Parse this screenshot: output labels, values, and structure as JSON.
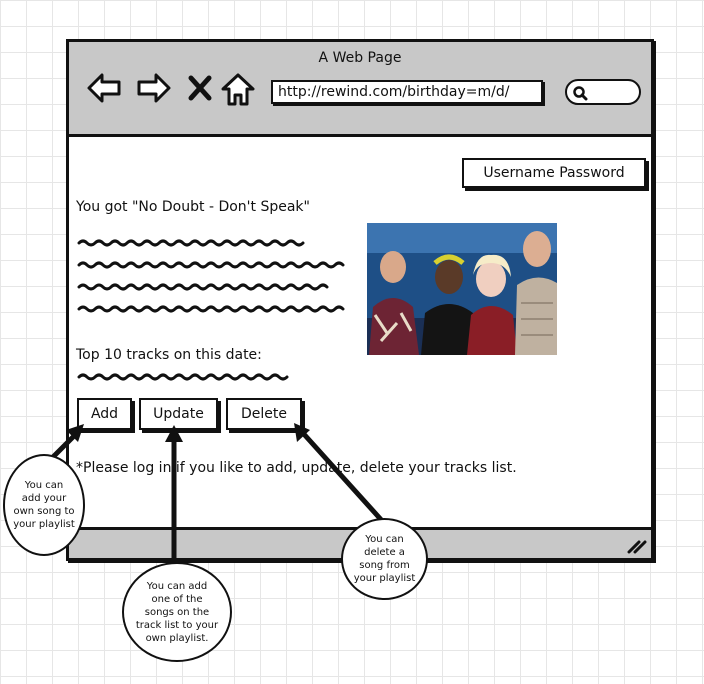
{
  "browser": {
    "window_title": "A Web Page",
    "url": "http://rewind.com/birthday=m/d/",
    "nav_icons": [
      "back-arrow-icon",
      "forward-arrow-icon",
      "stop-icon",
      "home-icon"
    ],
    "search_icon": "magnifier-icon"
  },
  "page": {
    "login_label": "Username Password",
    "song_result": "You got \"No Doubt - Don't Speak\"",
    "tracks_heading": "Top 10 tracks on this date:",
    "buttons": {
      "add": "Add",
      "update": "Update",
      "delete": "Delete"
    },
    "login_note": "*Please log in if you like to add, update, delete your tracks list."
  },
  "annotations": {
    "add": [
      "You can",
      "add your",
      "own song to",
      "your playlist"
    ],
    "update": [
      "You can add",
      "one of the",
      "songs on the",
      "track list to your",
      "own playlist."
    ],
    "delete": [
      "You can",
      "delete a",
      "song from",
      "your playlist"
    ]
  },
  "colors": {
    "toolbar": "#c8c8c8",
    "stroke": "#111111",
    "grid": "#e6e6e6"
  }
}
